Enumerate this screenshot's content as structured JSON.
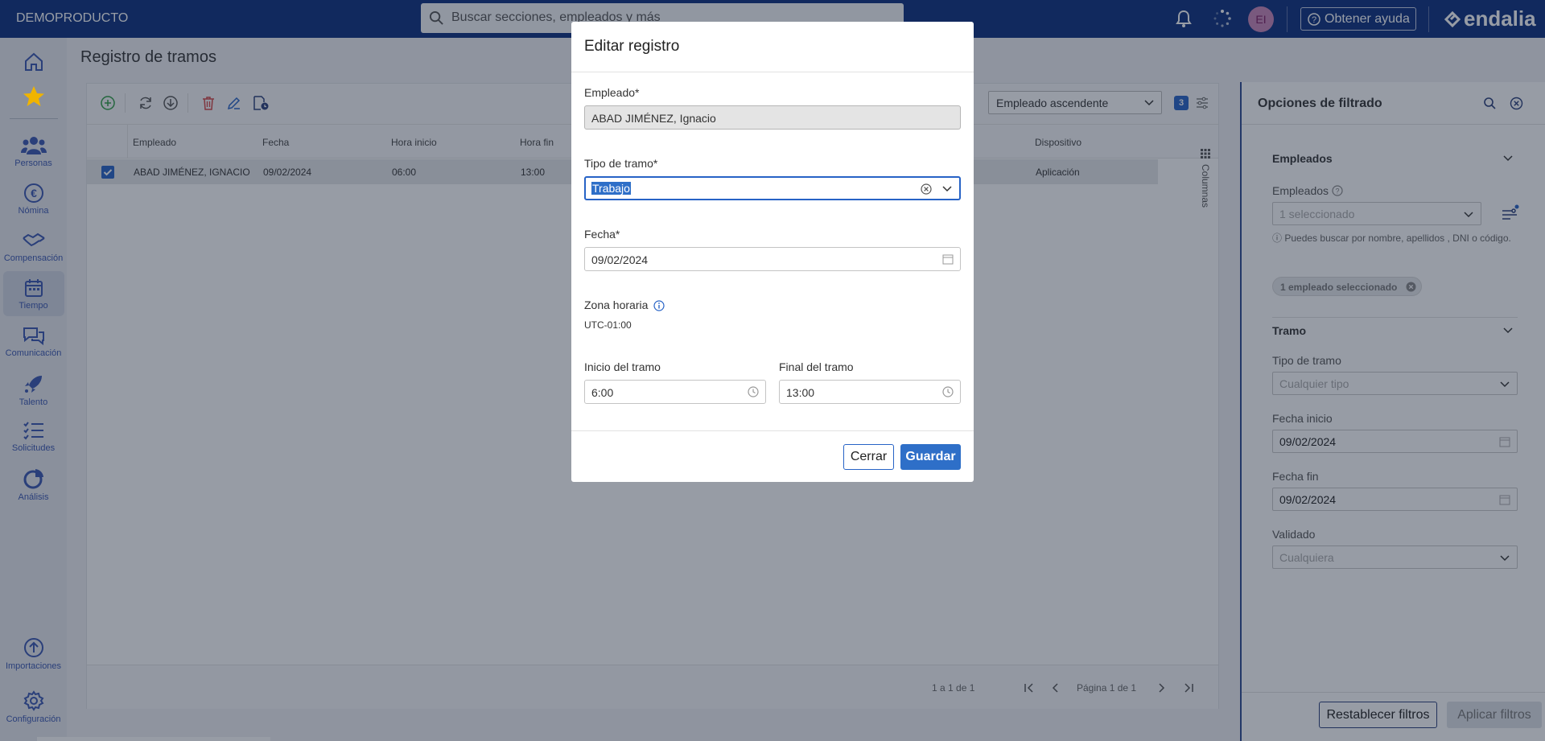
{
  "topbar": {
    "brand": "DEMOPRODUCTO",
    "search_placeholder": "Buscar secciones, empleados y más",
    "avatar_initials": "EI",
    "help_label": "Obtener ayuda",
    "logo": "endalia"
  },
  "sidebar": {
    "items": [
      {
        "label": "",
        "icon": "home-icon"
      },
      {
        "label": "",
        "icon": "star-icon"
      },
      {
        "label": "Personas",
        "icon": "people-icon"
      },
      {
        "label": "Nómina",
        "icon": "euro-icon"
      },
      {
        "label": "Compensación",
        "icon": "handshake-icon"
      },
      {
        "label": "Tiempo",
        "icon": "calendar-icon",
        "active": true
      },
      {
        "label": "Comunicación",
        "icon": "chat-icon"
      },
      {
        "label": "Talento",
        "icon": "rocket-icon"
      },
      {
        "label": "Solicitudes",
        "icon": "checklist-icon"
      },
      {
        "label": "Análisis",
        "icon": "pie-chart-icon"
      },
      {
        "label": "Importaciones",
        "icon": "upload-icon"
      },
      {
        "label": "Configuración",
        "icon": "gear-icon"
      }
    ]
  },
  "page": {
    "title": "Registro de tramos"
  },
  "grid": {
    "sort_value": "Empleado ascendente",
    "badge_count": "3",
    "columns": [
      "Empleado",
      "Fecha",
      "Hora inicio",
      "Hora fin",
      "Dispositivo"
    ],
    "rows": [
      {
        "empleado": "ABAD JIMÉNEZ, IGNACIO",
        "fecha": "09/02/2024",
        "hora_inicio": "06:00",
        "hora_fin": "13:00",
        "dispositivo": "Aplicación"
      }
    ],
    "columns_panel_label": "Columnas",
    "pagination": {
      "summary": "1 a 1 de 1",
      "page_label": "Página 1 de 1"
    }
  },
  "filters": {
    "title": "Opciones de filtrado",
    "sections": {
      "employees": "Empleados",
      "segment": "Tramo"
    },
    "employees_label": "Empleados",
    "employees_value": "1 seleccionado",
    "employees_hint": "Puedes buscar por nombre, apellidos , DNI o código.",
    "employees_hint_icon": "ⓘ",
    "chip_label": "1 empleado seleccionado",
    "tipo_label": "Tipo de tramo",
    "tipo_value": "Cualquier tipo",
    "fecha_inicio_label": "Fecha inicio",
    "fecha_inicio_value": "09/02/2024",
    "fecha_fin_label": "Fecha fin",
    "fecha_fin_value": "09/02/2024",
    "validado_label": "Validado",
    "validado_value": "Cualquiera",
    "reset_label": "Restablecer filtros",
    "apply_label": "Aplicar filtros"
  },
  "modal": {
    "title": "Editar registro",
    "empleado_label": "Empleado*",
    "empleado_value": "ABAD JIMÉNEZ, Ignacio",
    "tipo_label": "Tipo de tramo*",
    "tipo_value": "Trabajo",
    "fecha_label": "Fecha*",
    "fecha_value": "09/02/2024",
    "zona_label": "Zona horaria",
    "zona_value": "UTC-01:00",
    "inicio_label": "Inicio del tramo",
    "inicio_value": "6:00",
    "final_label": "Final del tramo",
    "final_value": "13:00",
    "cerrar_label": "Cerrar",
    "guardar_label": "Guardar"
  },
  "colors": {
    "navy": "#0b2f7e",
    "accent": "#2763c6",
    "selection": "#2e6fc8"
  }
}
